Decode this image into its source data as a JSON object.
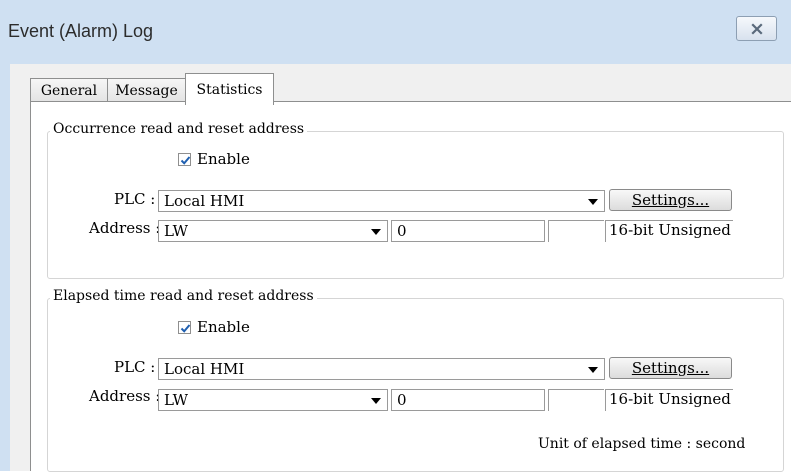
{
  "window": {
    "title": "Event (Alarm) Log"
  },
  "tabs": [
    {
      "label": "General"
    },
    {
      "label": "Message"
    },
    {
      "label": "Statistics",
      "active": true
    }
  ],
  "occurrence": {
    "legend": "Occurrence read and reset address",
    "enable_label": "Enable",
    "enabled": true,
    "plc_label": "PLC :",
    "plc_value": "Local HMI",
    "settings_label": "Settings...",
    "address_label": "Address :",
    "address_device": "LW",
    "address_value": "0",
    "address_extra": "",
    "data_format": "16-bit Unsigned"
  },
  "elapsed": {
    "legend": "Elapsed time read and reset address",
    "enable_label": "Enable",
    "enabled": true,
    "plc_label": "PLC :",
    "plc_value": "Local HMI",
    "settings_label": "Settings...",
    "address_label": "Address :",
    "address_device": "LW",
    "address_value": "0",
    "address_extra": "",
    "data_format": "16-bit Unsigned",
    "unit_text": "Unit of elapsed time : second"
  },
  "colors": {
    "titlebar": "#cfe0f2",
    "dialog_bg": "#f0f0f0",
    "check": "#1f5fb0"
  }
}
